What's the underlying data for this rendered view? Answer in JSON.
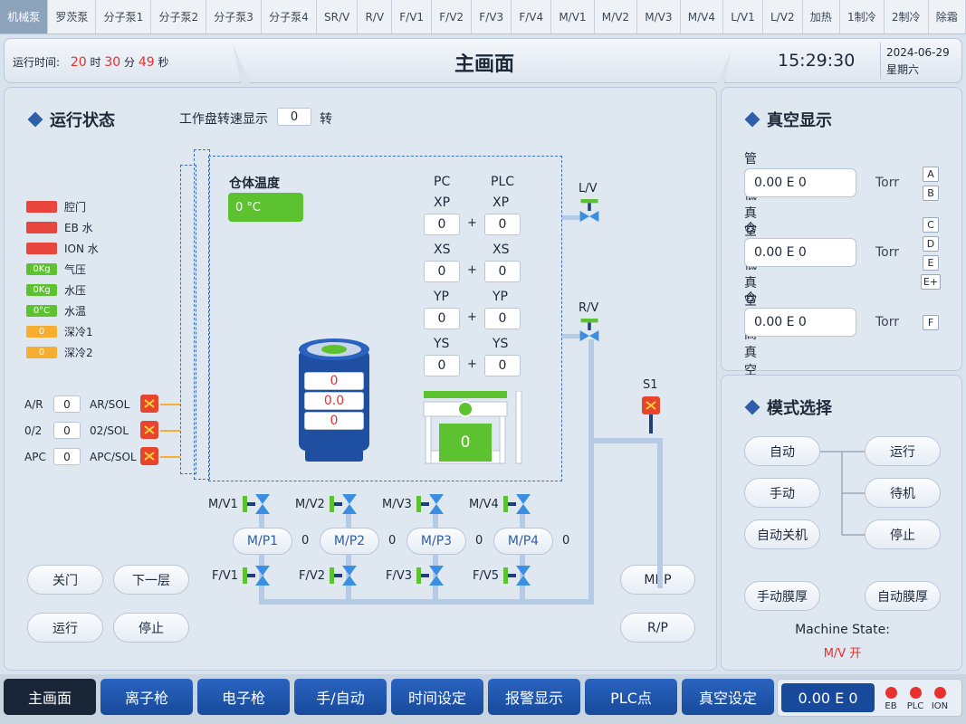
{
  "top_tabs": [
    "机械泵",
    "罗茨泵",
    "分子泵1",
    "分子泵2",
    "分子泵3",
    "分子泵4",
    "SR/V",
    "R/V",
    "F/V1",
    "F/V2",
    "F/V3",
    "F/V4",
    "M/V1",
    "M/V2",
    "M/V3",
    "M/V4",
    "L/V1",
    "L/V2",
    "加热",
    "1制冷",
    "2制冷",
    "除霜"
  ],
  "header": {
    "runtime_label": "运行时间:",
    "hours": "20",
    "hours_unit": "时",
    "minutes": "30",
    "minutes_unit": "分",
    "seconds": "49",
    "seconds_unit": "秒",
    "title": "主画面",
    "clock": "15:29:30",
    "date": "2024-06-29",
    "weekday": "星期六"
  },
  "status": {
    "title": "运行状态",
    "disk_label": "工作盘转速显示",
    "disk_value": "0",
    "disk_unit": "转",
    "indicators": [
      {
        "text": "",
        "label": "腔门",
        "color": "#e8453c"
      },
      {
        "text": "",
        "label": "EB 水",
        "color": "#e8453c"
      },
      {
        "text": "",
        "label": "ION 水",
        "color": "#e8453c"
      },
      {
        "text": "0Kg",
        "label": "气压",
        "color": "#5cc230"
      },
      {
        "text": "0Kg",
        "label": "水压",
        "color": "#5cc230"
      },
      {
        "text": "0°C",
        "label": "水温",
        "color": "#5cc230"
      },
      {
        "text": "0",
        "label": "深冷1",
        "color": "#f7ad2f"
      },
      {
        "text": "0",
        "label": "深冷2",
        "color": "#f7ad2f"
      }
    ],
    "gas": [
      {
        "label": "A/R",
        "value": "0",
        "sol": "AR/SOL"
      },
      {
        "label": "0/2",
        "value": "0",
        "sol": "02/SOL"
      },
      {
        "label": "APC",
        "value": "0",
        "sol": "APC/SOL"
      }
    ],
    "chamber_temp_label": "仓体温度",
    "chamber_temp": "0 °C",
    "pc_label": "PC",
    "plc_label": "PLC",
    "axes": [
      {
        "name": "XP",
        "pc": "0",
        "plc": "0"
      },
      {
        "name": "XS",
        "pc": "0",
        "plc": "0"
      },
      {
        "name": "YP",
        "pc": "0",
        "plc": "0"
      },
      {
        "name": "YS",
        "pc": "0",
        "plc": "0"
      }
    ],
    "plus": "+",
    "drum": [
      "0",
      "0.0",
      "0"
    ],
    "stage_value": "0",
    "lv_label": "L/V",
    "rv_label": "R/V",
    "s1_label": "S1",
    "mv": [
      "M/V1",
      "M/V2",
      "M/V3",
      "M/V4"
    ],
    "mp": [
      {
        "label": "M/P1",
        "value": "0"
      },
      {
        "label": "M/P2",
        "value": "0"
      },
      {
        "label": "M/P3",
        "value": "0"
      },
      {
        "label": "M/P4",
        "value": "0"
      }
    ],
    "fv": [
      "F/V1",
      "F/V2",
      "F/V3",
      "F/V5"
    ],
    "buttons": {
      "close_door": "关门",
      "next_layer": "下一层",
      "run": "运行",
      "stop": "停止",
      "mbp": "MBP",
      "rp": "R/P"
    }
  },
  "vacuum": {
    "title": "真空显示",
    "rows": [
      {
        "label": "管道低真空",
        "value": "0.00 E 0",
        "unit": "Torr",
        "chips": [
          "A",
          "B"
        ]
      },
      {
        "label": "仓体低真空",
        "value": "0.00 E 0",
        "unit": "Torr",
        "chips": [
          "C",
          "D",
          "E",
          "E+"
        ]
      },
      {
        "label": "仓体高真空",
        "value": "0.00 E 0",
        "unit": "Torr",
        "chips": [
          "F"
        ]
      }
    ]
  },
  "mode": {
    "title": "模式选择",
    "auto": "自动",
    "manual": "手动",
    "auto_off": "自动关机",
    "run": "运行",
    "standby": "待机",
    "stop": "停止",
    "manual_film": "手动膜厚",
    "auto_film": "自动膜厚",
    "state_label": "Machine State:",
    "state_value": "M/V 开"
  },
  "bottom": {
    "tabs": [
      "主画面",
      "离子枪",
      "电子枪",
      "手/自动",
      "时间设定",
      "报警显示",
      "PLC点",
      "真空设定"
    ],
    "reading": "0.00 E 0",
    "leds": [
      "EB",
      "PLC",
      "ION"
    ]
  },
  "colors": {
    "accent": "#2e5fa8",
    "alarm": "#e8453c",
    "ok": "#5cc230",
    "warn": "#f7ad2f"
  }
}
